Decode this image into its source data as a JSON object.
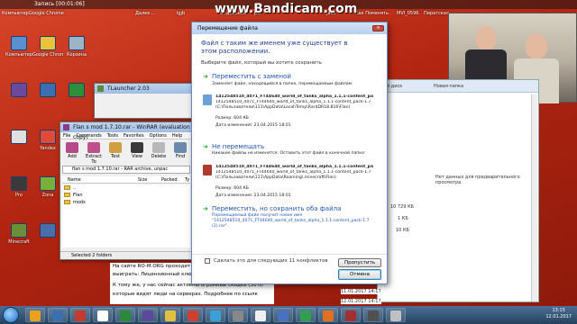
{
  "recording": {
    "label": "Запись [00:01:06]"
  },
  "watermark": "www.Bandicam.com",
  "desktop_icons": [
    {
      "label": "Компьютер",
      "color": "#5a8fd0"
    },
    {
      "label": "Google Chrome",
      "color": "#e9c23a"
    },
    {
      "label": "Корзина",
      "color": "#9cb4c8"
    },
    {
      "label": "",
      "color": "#6a4a9c"
    },
    {
      "label": "",
      "color": "#3b6fb0"
    },
    {
      "label": "",
      "color": "#2c8f3c"
    },
    {
      "label": "",
      "color": "#e0e0e0"
    },
    {
      "label": "Yandex",
      "color": "#e04a3a"
    },
    {
      "label": "Kolibri Klass.ru",
      "color": "#f0a030"
    },
    {
      "label": "Pro",
      "color": "#3a3a3a"
    },
    {
      "label": "Zona",
      "color": "#7ab03a"
    },
    {
      "label": "Mortal Kombat",
      "color": "#444"
    },
    {
      "label": "Minecraft",
      "color": "#6b8e3a"
    },
    {
      "label": "",
      "color": "#4a6fa8"
    },
    {
      "label": "Ваши файлы",
      "color": "#d86a2a"
    }
  ],
  "top_labels": [
    "Компьютер",
    "Google Chrome",
    "Далее...",
    "lgjb",
    "Отдельная",
    "ps/",
    "java",
    "Как Поменять",
    "MVI_0596",
    "Пиратская"
  ],
  "tlauncher": {
    "title": "TLauncher 2.03"
  },
  "winrar": {
    "title": "Flan s mod 1.7.10.rar - WinRAR (evaluation copy)",
    "menu": [
      "File",
      "Commands",
      "Tools",
      "Favorites",
      "Options",
      "Help"
    ],
    "tools": [
      "Add",
      "Extract To",
      "Test",
      "View",
      "Delete",
      "Find"
    ],
    "path": "flan s mod 1.7.10.rar - RAR archive, unpac",
    "columns": [
      "Name",
      "Size",
      "Packed",
      "Ty"
    ],
    "rows": [
      "..",
      "Flan",
      "mods"
    ],
    "status": "Selected 2 folders"
  },
  "explorer": {
    "toolbar": [
      "Новая папка"
    ],
    "hint": "Нет данных для предварительного просмотра.",
    "menu_right": [
      "Выбор",
      "ый диск"
    ],
    "sizes": [
      "10 729 КБ",
      "1 КБ",
      "10 КБ"
    ],
    "date_modified": "11.01.2017 14:17",
    "date_changed": "12.01.2017 14:17"
  },
  "dialog": {
    "title": "Перемещение файла",
    "heading": "Файл с таким же именем уже существует в этом расположении.",
    "subheading": "Выберите файл, который вы хотите сохранить",
    "options": [
      {
        "title": "Переместить с заменой",
        "desc": "Заменяет файл, находящийся в папке, перемещаемым файлом.",
        "filename": "1412548510_4071_FT44640_world_of_tanks_alpha_1.1.1-content_pa",
        "path": "1412548510_4071_FT44640_world_of_tanks_alpha_1.1.1-content_pack-1.7 (C:\\Пользователи\\111\\AppData\\Local\\Temp\\Rar$DR18.816\\Flan)",
        "size": "Размер: 604 КБ",
        "date": "Дата изменения: 23.04.2015 18:01",
        "icon_color": "#6fa1d8"
      },
      {
        "title": "Не перемещать",
        "desc": "Никакие файлы не изменятся. Оставить этот файл в конечной папке:",
        "filename": "1412548510_4071_FT44640_world_of_tanks_alpha_1.1.1-content_pa",
        "path": "1412548510_4071_FT44640_world_of_tanks_alpha_1.1.1-content_pack-1.7 (C:\\Пользователи\\111\\AppData\\Roaming\\.minecraft\\Flan)",
        "size": "Размер: 604 КБ",
        "date": "Дата изменения: 23.04.2015 18:01",
        "icon_color": "#b03a2e"
      },
      {
        "title": "Переместить, но сохранить оба файла",
        "desc": "Перемещаемый файл получит новое имя \"1412548510_4071_FT44640_world_of_tanks_alpha_1.1.1-content_pack-1.7 (2).rar\""
      }
    ],
    "checkbox": "Сделать это для следующих 11 конфликтов",
    "skip_button": "Пропустить",
    "cancel_button": "Отмена"
  },
  "behind_text": [
    "На сайте RO-M.ORG проходит кон",
    "выиграть: Лицензионный ключ",
    "К тому же, у нас сейчас активны огромные скидки (50%)",
    "которые видят люди на серверах. Подробнее по ссылк"
  ],
  "taskbar": {
    "time": "13:15",
    "date": "12.01.2017",
    "apps": [
      "#e8a020",
      "#3a6fb0",
      "#c63a2e",
      "#ffffff",
      "#2a8a3a",
      "#5a4a9a",
      "#e0c040",
      "#d04030",
      "#3aa0d8",
      "#888888",
      "#f0f0f0",
      "#4a70c0",
      "#30a050",
      "#e07020",
      "#a03030",
      "#505050",
      "#c0c0c0"
    ]
  }
}
